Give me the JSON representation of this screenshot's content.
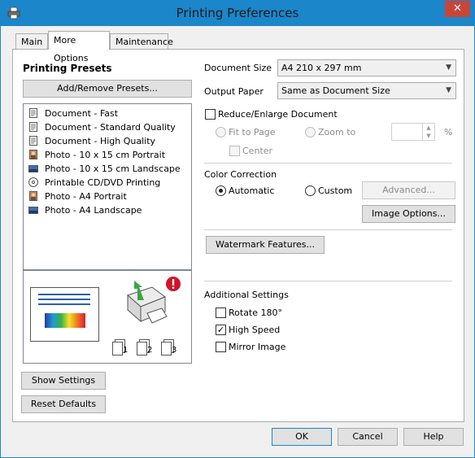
{
  "window": {
    "title": "Printing Preferences",
    "close_glyph": "✕"
  },
  "tabs": [
    {
      "label": "Main",
      "active": false
    },
    {
      "label": "More Options",
      "active": true
    },
    {
      "label": "Maintenance",
      "active": false
    }
  ],
  "presets": {
    "heading": "Printing Presets",
    "add_remove_label": "Add/Remove Presets...",
    "items": [
      {
        "label": "Document - Fast",
        "icon": "document-icon"
      },
      {
        "label": "Document - Standard Quality",
        "icon": "document-icon"
      },
      {
        "label": "Document - High Quality",
        "icon": "document-icon"
      },
      {
        "label": "Photo - 10 x 15 cm Portrait",
        "icon": "photo-portrait-icon"
      },
      {
        "label": "Photo - 10 x 15 cm Landscape",
        "icon": "photo-landscape-icon"
      },
      {
        "label": "Printable CD/DVD Printing",
        "icon": "cd-icon"
      },
      {
        "label": "Photo - A4 Portrait",
        "icon": "photo-portrait-icon"
      },
      {
        "label": "Photo - A4 Landscape",
        "icon": "photo-landscape-icon"
      }
    ]
  },
  "preview": {
    "page_labels": [
      "1",
      "2",
      "3"
    ]
  },
  "left_buttons": {
    "show_settings": "Show Settings",
    "reset_defaults": "Reset Defaults"
  },
  "document_size": {
    "label": "Document Size",
    "value": "A4 210 x 297 mm"
  },
  "output_paper": {
    "label": "Output Paper",
    "value": "Same as Document Size"
  },
  "reduce_enlarge": {
    "label": "Reduce/Enlarge Document",
    "checked": false,
    "fit_to_page": "Fit to Page",
    "zoom_to": "Zoom to",
    "zoom_unit": "%",
    "center": "Center"
  },
  "color_correction": {
    "heading": "Color Correction",
    "automatic": "Automatic",
    "custom": "Custom",
    "selected": "Automatic",
    "advanced_label": "Advanced...",
    "image_options_label": "Image Options..."
  },
  "watermark_label": "Watermark Features...",
  "additional": {
    "heading": "Additional Settings",
    "rotate": {
      "label": "Rotate 180°",
      "checked": false
    },
    "high_speed": {
      "label": "High Speed",
      "checked": true
    },
    "mirror": {
      "label": "Mirror Image",
      "checked": false
    }
  },
  "footer": {
    "ok": "OK",
    "cancel": "Cancel",
    "help": "Help"
  },
  "colors": {
    "accent": "#1b86c9",
    "close_button": "#c7463a",
    "warning": "#d0142a",
    "arrow_green": "#3aa640"
  }
}
